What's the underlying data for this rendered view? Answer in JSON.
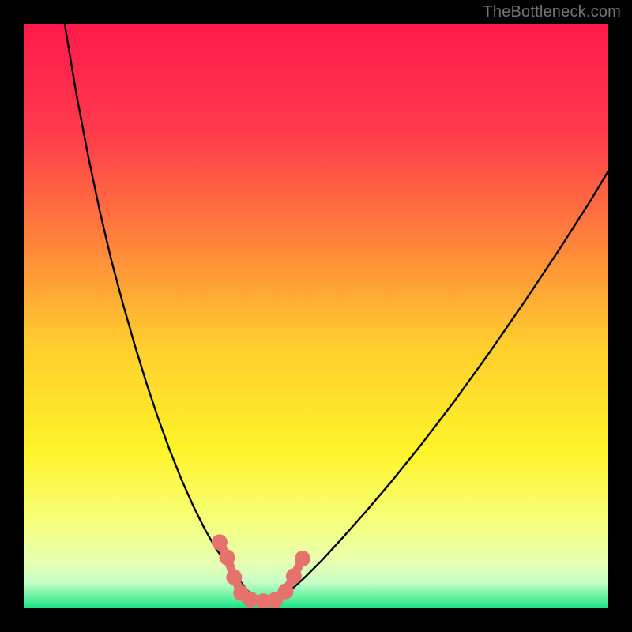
{
  "watermark": "TheBottleneck.com",
  "chart_data": {
    "type": "line",
    "title": "",
    "xlabel": "",
    "ylabel": "",
    "xlim": [
      0,
      1
    ],
    "ylim": [
      0,
      1
    ],
    "gradient_stops": [
      {
        "offset": 0.0,
        "color": "#ff1a4b"
      },
      {
        "offset": 0.18,
        "color": "#ff394d"
      },
      {
        "offset": 0.35,
        "color": "#ff7a3d"
      },
      {
        "offset": 0.55,
        "color": "#ffce2e"
      },
      {
        "offset": 0.73,
        "color": "#fff429"
      },
      {
        "offset": 0.85,
        "color": "#f6ff7a"
      },
      {
        "offset": 0.92,
        "color": "#e8ffb0"
      },
      {
        "offset": 0.955,
        "color": "#c8ffc8"
      },
      {
        "offset": 0.985,
        "color": "#58ef9c"
      },
      {
        "offset": 1.0,
        "color": "#17e082"
      }
    ],
    "series": [
      {
        "name": "left-curve",
        "x": [
          0.07,
          0.09,
          0.11,
          0.13,
          0.15,
          0.17,
          0.19,
          0.21,
          0.23,
          0.25,
          0.27,
          0.29,
          0.31,
          0.33,
          0.345,
          0.36,
          0.375,
          0.39,
          0.4
        ],
        "y": [
          0.0,
          0.12,
          0.225,
          0.32,
          0.405,
          0.48,
          0.55,
          0.615,
          0.675,
          0.73,
          0.78,
          0.825,
          0.865,
          0.9,
          0.92,
          0.94,
          0.96,
          0.978,
          0.988
        ]
      },
      {
        "name": "right-curve",
        "x": [
          0.43,
          0.445,
          0.46,
          0.48,
          0.51,
          0.545,
          0.585,
          0.63,
          0.68,
          0.735,
          0.795,
          0.855,
          0.915,
          0.97,
          1.0
        ],
        "y": [
          0.988,
          0.978,
          0.966,
          0.948,
          0.918,
          0.88,
          0.835,
          0.782,
          0.72,
          0.648,
          0.565,
          0.478,
          0.388,
          0.302,
          0.252
        ]
      }
    ],
    "bead_chain": {
      "color": "#e5726d",
      "bead_radius": 10,
      "link_width": 11,
      "points": [
        {
          "x": 0.335,
          "y": 0.887
        },
        {
          "x": 0.348,
          "y": 0.913
        },
        {
          "x": 0.36,
          "y": 0.947
        },
        {
          "x": 0.372,
          "y": 0.974
        },
        {
          "x": 0.388,
          "y": 0.985
        },
        {
          "x": 0.41,
          "y": 0.988
        },
        {
          "x": 0.43,
          "y": 0.986
        },
        {
          "x": 0.448,
          "y": 0.971
        },
        {
          "x": 0.462,
          "y": 0.945
        },
        {
          "x": 0.477,
          "y": 0.915
        }
      ]
    }
  }
}
